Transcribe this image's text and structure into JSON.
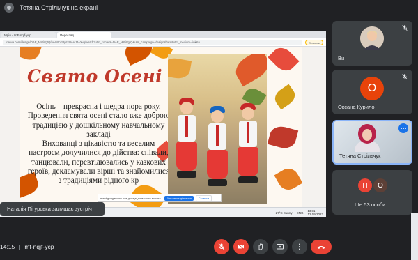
{
  "header": {
    "title": "Тетяна Стрільчук на екрані"
  },
  "browser": {
    "tabs": [
      "Мрія - ImF-nqjf-ycp",
      "Перегляд"
    ],
    "url": "canva.com/design/DAE_M8tiVgtQ/nx-MCvz2pzzUAelJJAXvg/watch?utm_content=DAE_M8tiVgtQ&utm_campaign=designshare&utm_medium=link&u...",
    "pill_label": "Оновити"
  },
  "slide": {
    "title": "Свято Осені",
    "text": "Осінь – прекрасна і щедра пора року. Проведення свята осені стало вже доброю традицією у дошкільному навчальному закладі\nВихованці з цікавістю та веселим настроєм долучилися до дійства: співали, танцювали, перевтілювались у казкових героїв, декламували вірші та знайомилися з традиціями рідного кр"
  },
  "taskbar": {
    "weather": "27°C Sunny",
    "lang": "ENG",
    "time": "13:11",
    "date": "12.09.2022"
  },
  "share_banner": {
    "text": "meet.google.com має доступ до вашого екрана.",
    "stop_label": "Більше не ділитися",
    "hide_label": "Сховати"
  },
  "toast": {
    "text": "Наталія Пігурська залишає зустріч"
  },
  "participants": [
    {
      "name": "Ви",
      "muted": true
    },
    {
      "name": "Оксана Курило",
      "initial": "О",
      "color": "#e8430a",
      "muted": true
    },
    {
      "name": "Тетяна Стрільчук"
    },
    {
      "name": "Ще 53 особи",
      "initials": [
        "Н",
        "О"
      ],
      "colors": [
        "#ea4335",
        "#5d4037"
      ]
    }
  ],
  "meeting": {
    "time": "14:15",
    "code": "imf-nqjf-ycp"
  },
  "colors": {
    "background": "#202124",
    "tile": "#3c4043",
    "danger": "#ea4335",
    "accent": "#8ab4f8"
  }
}
